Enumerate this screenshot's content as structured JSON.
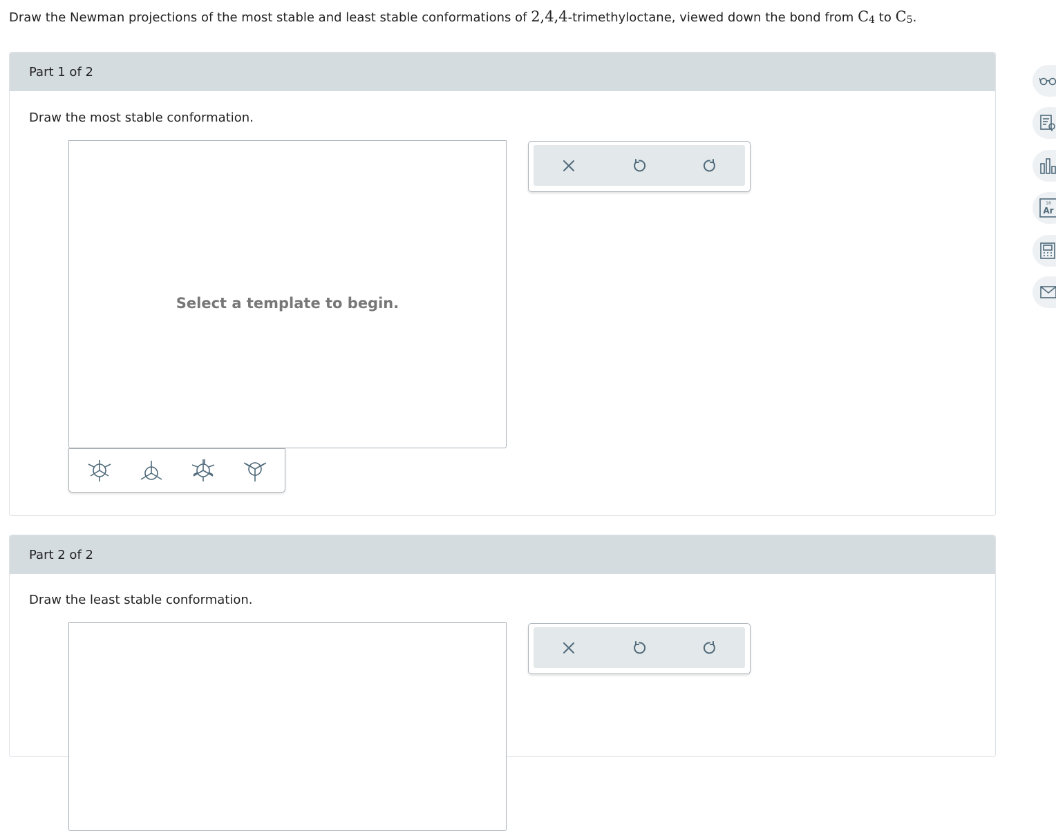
{
  "question": {
    "text_before": "Draw the Newman projections of the most stable and least stable conformations of ",
    "compound_number": "2,4,4",
    "compound_name": "-trimethyloctane, viewed down the bond from ",
    "from_atom": "C",
    "from_sub": "4",
    "to_word": " to ",
    "to_atom": "C",
    "to_sub": "5",
    "end": "."
  },
  "parts": [
    {
      "header": "Part 1 of 2",
      "prompt": "Draw the most stable conformation.",
      "canvas_message": "Select a template to begin.",
      "templates": [
        "staggered-template-icon",
        "staggered-front-template-icon",
        "eclipsed-template-icon",
        "eclipsed-back-template-icon"
      ],
      "tools": [
        "clear-icon",
        "undo-icon",
        "redo-icon"
      ]
    },
    {
      "header": "Part 2 of 2",
      "prompt": "Draw the least stable conformation.",
      "tools": [
        "clear-icon",
        "undo-icon",
        "redo-icon"
      ]
    }
  ],
  "sidebar": {
    "periodic_number": "18",
    "periodic_symbol": "Ar",
    "icons": [
      "glasses-icon",
      "explanation-icon",
      "chart-icon",
      "periodic-table-icon",
      "calculator-icon",
      "mail-icon"
    ]
  },
  "colors": {
    "header_bg": "#d5dce0",
    "toolbox_bg": "#e3e8eb",
    "icon": "#4f6a7a"
  }
}
